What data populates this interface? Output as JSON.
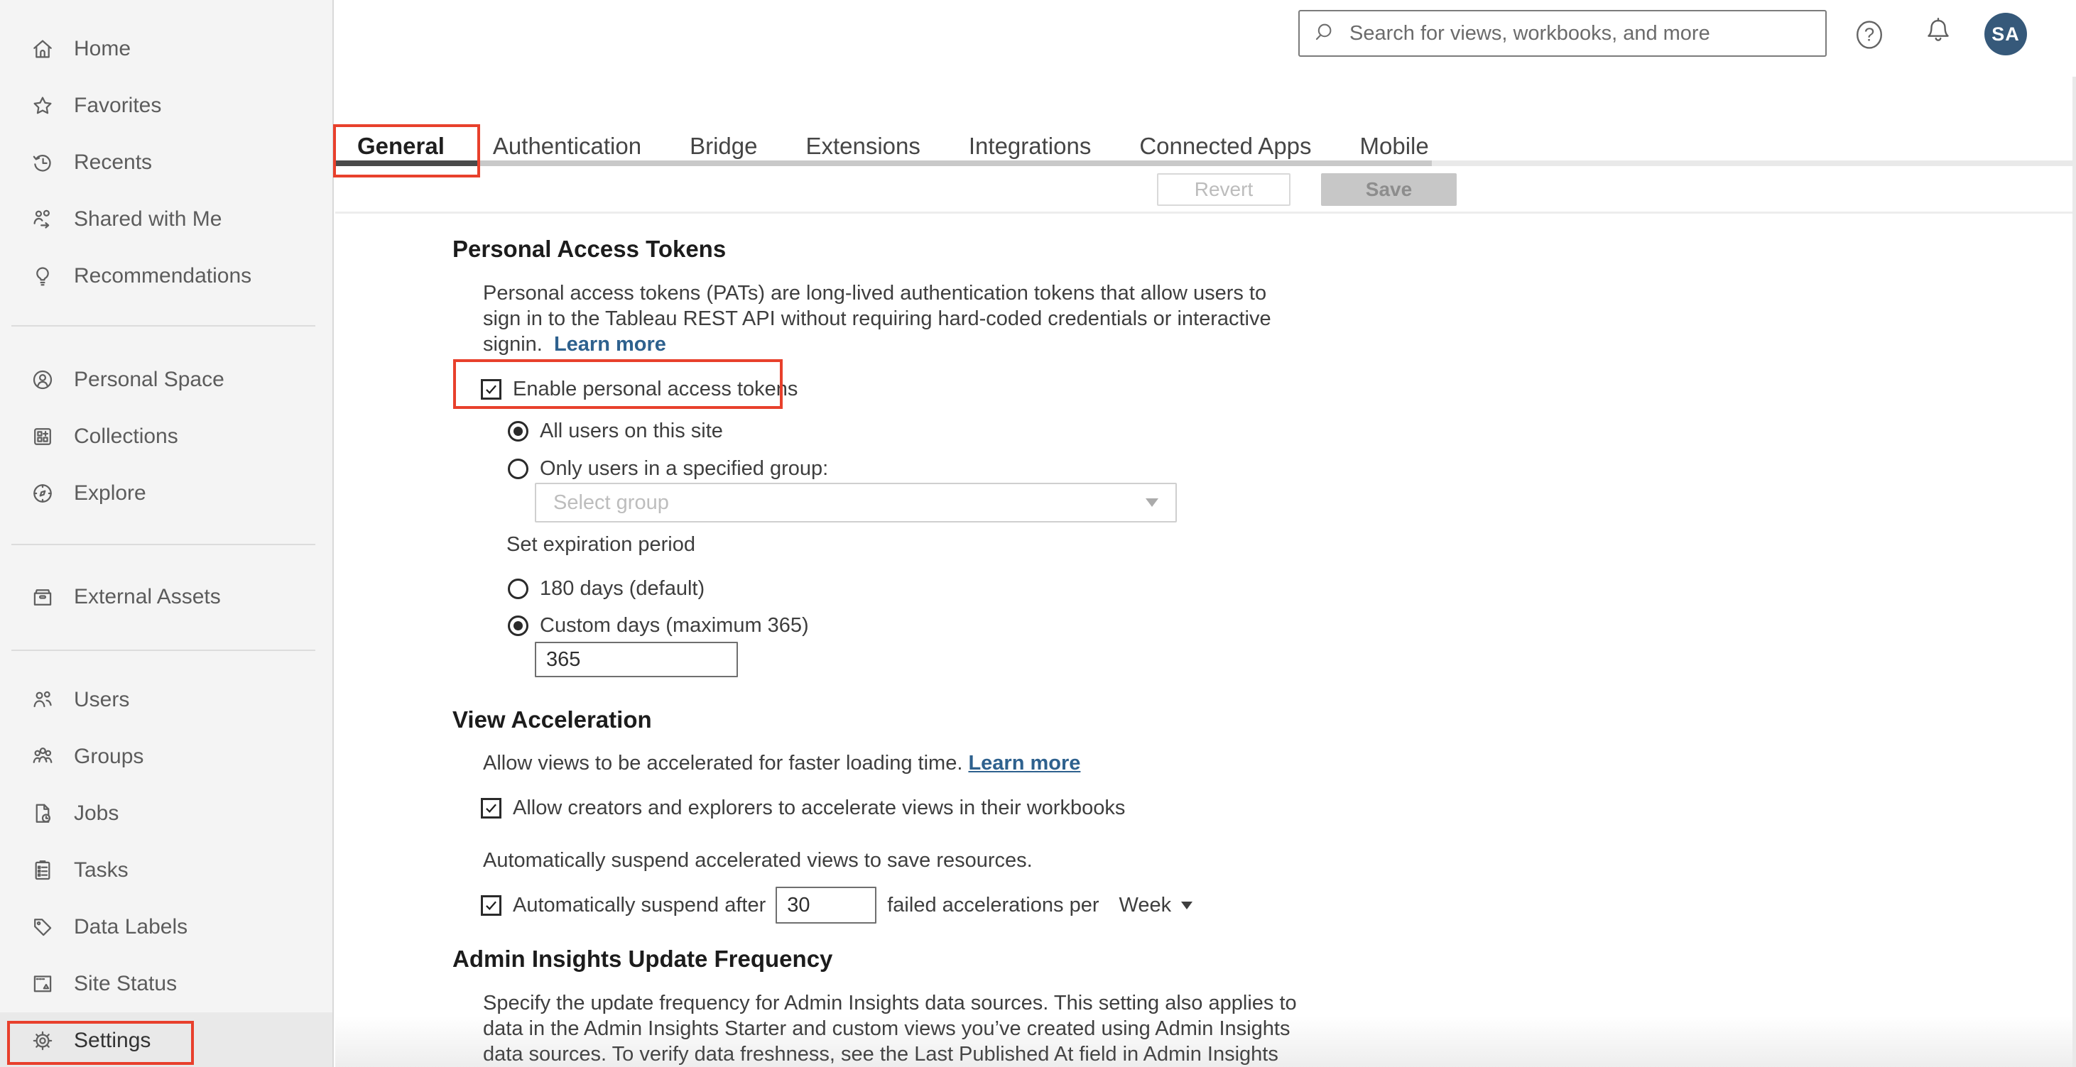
{
  "colors": {
    "annotation_red": "#e8402c",
    "link_blue": "#2e618e",
    "avatar_bg": "#36597a",
    "tab_underline_dark": "#4a4a4a",
    "sidebar_bg": "#f4f4f4"
  },
  "topbar": {
    "search_placeholder": "Search for views, workbooks, and more",
    "avatar_initials": "SA"
  },
  "sidebar": {
    "items": [
      {
        "label": "Home",
        "icon": "home-icon"
      },
      {
        "label": "Favorites",
        "icon": "favorites-icon"
      },
      {
        "label": "Recents",
        "icon": "recents-icon"
      },
      {
        "label": "Shared with Me",
        "icon": "shared-with-me-icon"
      },
      {
        "label": "Recommendations",
        "icon": "recommendations-icon"
      },
      {
        "label": "Personal Space",
        "icon": "personal-space-icon"
      },
      {
        "label": "Collections",
        "icon": "collections-icon"
      },
      {
        "label": "Explore",
        "icon": "explore-icon"
      },
      {
        "label": "External Assets",
        "icon": "external-assets-icon"
      },
      {
        "label": "Users",
        "icon": "users-icon"
      },
      {
        "label": "Groups",
        "icon": "groups-icon"
      },
      {
        "label": "Jobs",
        "icon": "jobs-icon"
      },
      {
        "label": "Tasks",
        "icon": "tasks-icon"
      },
      {
        "label": "Data Labels",
        "icon": "data-labels-icon"
      },
      {
        "label": "Site Status",
        "icon": "site-status-icon"
      },
      {
        "label": "Settings",
        "icon": "settings-icon",
        "selected": true
      }
    ]
  },
  "tabs": {
    "items": [
      "General",
      "Authentication",
      "Bridge",
      "Extensions",
      "Integrations",
      "Connected Apps",
      "Mobile"
    ],
    "selected": "General"
  },
  "toolbar": {
    "revert_label": "Revert",
    "save_label": "Save"
  },
  "pat": {
    "title": "Personal Access Tokens",
    "desc_line1": "Personal access tokens (PATs) are long-lived authentication tokens that allow users to",
    "desc_line2": "sign in to the Tableau REST API without requiring hard-coded credentials or interactive",
    "desc_line3": "signin.",
    "learn_more": "Learn more",
    "enable_label": "Enable personal access tokens",
    "enable_checked": true,
    "scope_all_label": "All users on this site",
    "scope_group_label": "Only users in a specified group:",
    "scope_selected": "All users on this site",
    "group_select_placeholder": "Select group",
    "expiration_label": "Set expiration period",
    "expiration_default_label": "180 days (default)",
    "expiration_custom_label": "Custom days (maximum 365)",
    "expiration_selected": "Custom days (maximum 365)",
    "custom_days_value": "365"
  },
  "view_acceleration": {
    "title": "View Acceleration",
    "description": "Allow views to be accelerated for faster loading time.",
    "learn_more": "Learn more",
    "allow_label": "Allow creators and explorers to accelerate views in their workbooks",
    "allow_checked": true,
    "suspend_note": "Automatically suspend accelerated views to save resources.",
    "suspend_prefix": "Automatically suspend after",
    "suspend_value": "30",
    "suspend_suffix": "failed accelerations per",
    "suspend_checked": true,
    "period_value": "Week"
  },
  "admin_insights": {
    "title": "Admin Insights Update Frequency",
    "desc_line1": "Specify the update frequency for Admin Insights data sources. This setting also applies to",
    "desc_line2": "data in the Admin Insights Starter and custom views you’ve created using Admin Insights",
    "desc_line3": "data sources. To verify data freshness, see the Last Published At field in Admin Insights"
  }
}
